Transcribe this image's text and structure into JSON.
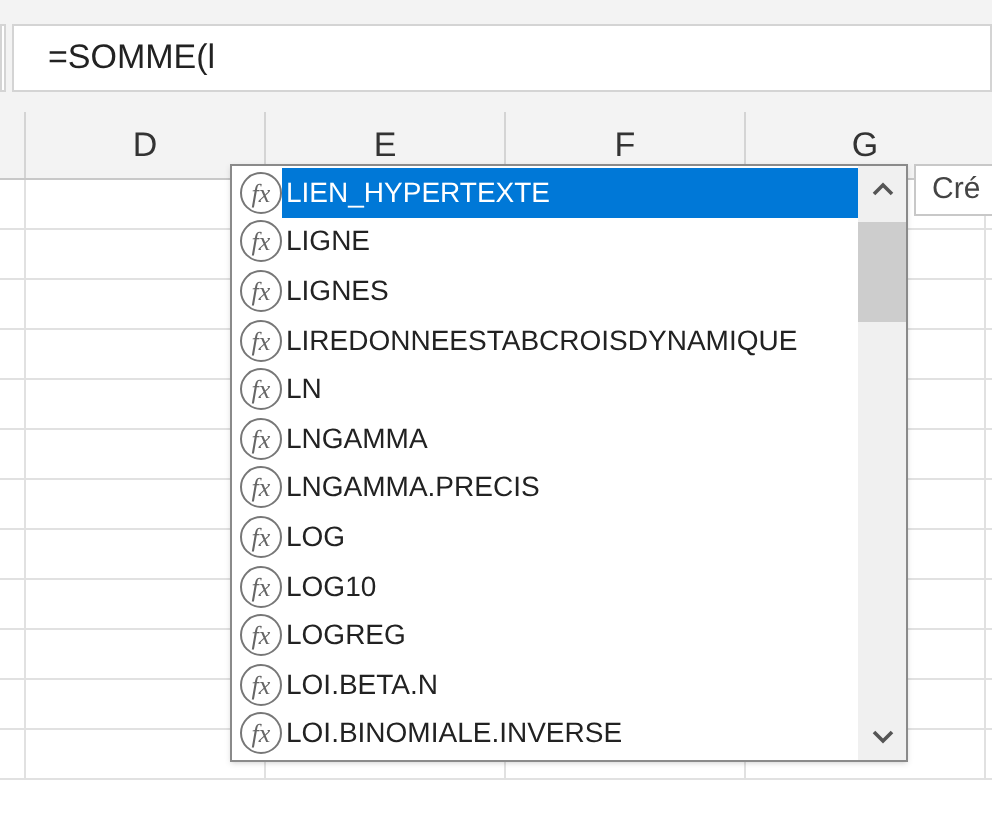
{
  "formula_bar": {
    "value": "=SOMME(l"
  },
  "column_headers": [
    "D",
    "E",
    "F",
    "G"
  ],
  "autocomplete": {
    "items": [
      {
        "icon": "fx",
        "label": "LIEN_HYPERTEXTE",
        "selected": true
      },
      {
        "icon": "fx",
        "label": "LIGNE",
        "selected": false
      },
      {
        "icon": "fx",
        "label": "LIGNES",
        "selected": false
      },
      {
        "icon": "fx",
        "label": "LIREDONNEESTABCROISDYNAMIQUE",
        "selected": false
      },
      {
        "icon": "fx",
        "label": "LN",
        "selected": false
      },
      {
        "icon": "fx",
        "label": "LNGAMMA",
        "selected": false
      },
      {
        "icon": "fx",
        "label": "LNGAMMA.PRECIS",
        "selected": false
      },
      {
        "icon": "fx",
        "label": "LOG",
        "selected": false
      },
      {
        "icon": "fx",
        "label": "LOG10",
        "selected": false
      },
      {
        "icon": "fx",
        "label": "LOGREG",
        "selected": false
      },
      {
        "icon": "fx",
        "label": "LOI.BETA.N",
        "selected": false
      },
      {
        "icon": "fx",
        "label": "LOI.BINOMIALE.INVERSE",
        "selected": false
      }
    ]
  },
  "tooltip": {
    "text": "Cré"
  }
}
